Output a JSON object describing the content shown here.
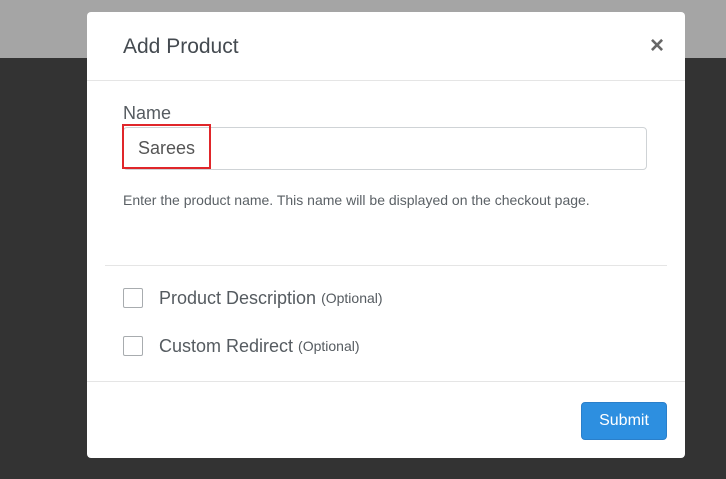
{
  "modal": {
    "title": "Add Product",
    "close_glyph": "×"
  },
  "name_field": {
    "label": "Name",
    "value": "Sarees",
    "help": "Enter the product name. This name will be displayed on the checkout page."
  },
  "options": [
    {
      "label": "Product Description",
      "optional": "(Optional)",
      "checked": false
    },
    {
      "label": "Custom Redirect",
      "optional": "(Optional)",
      "checked": false
    }
  ],
  "footer": {
    "submit_label": "Submit"
  },
  "colors": {
    "primary_button": "#2d8fe0",
    "highlight": "#e0262a",
    "overlay": "#333333"
  },
  "icons": {
    "close": "close-icon"
  }
}
